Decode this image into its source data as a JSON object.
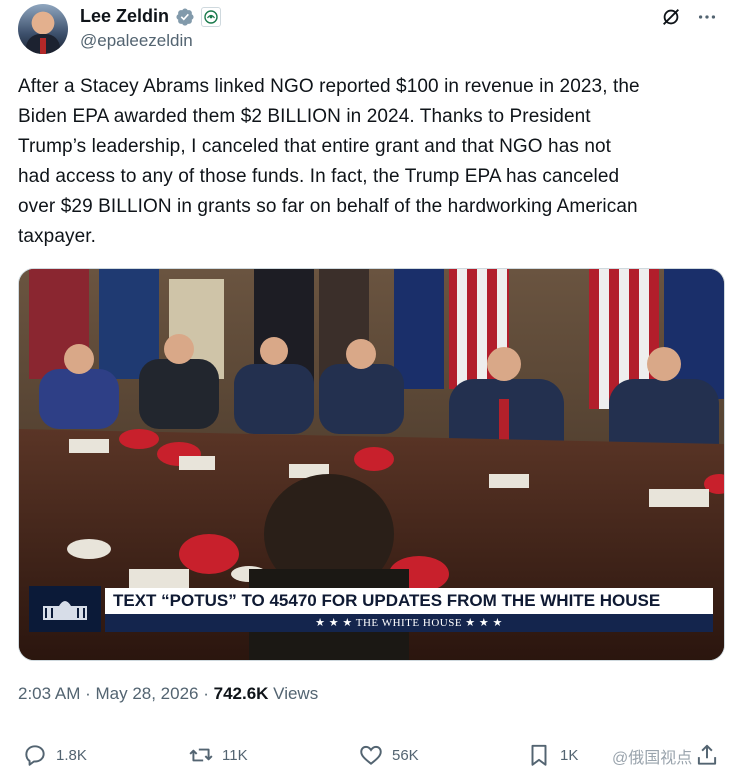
{
  "author": {
    "name": "Lee Zeldin",
    "handle": "@epaleezeldin"
  },
  "tweet": {
    "text": "After a Stacey Abrams linked NGO reported $100 in revenue in 2023, the\nBiden EPA awarded them $2 BILLION in 2024. Thanks to President\nTrump’s leadership, I canceled that entire grant and that NGO has not\nhad access to any of those funds. In fact, the Trump EPA has canceled\nover $29 BILLION in grants so far on behalf of the hardworking American\ntaxpayer."
  },
  "media": {
    "chyron_main": "TEXT “POTUS” TO 45470 FOR UPDATES FROM THE WHITE HOUSE",
    "chyron_sub": "★ ★ ★   THE WHITE HOUSE   ★ ★ ★"
  },
  "meta": {
    "time": "2:03 AM",
    "sep1": " · ",
    "date": "May 28, 2026",
    "sep2": " · ",
    "views_count": "742.6K",
    "views_label": " Views"
  },
  "actions": {
    "replies": "1.8K",
    "reposts": "11K",
    "likes": "56K",
    "bookmarks": "1K"
  },
  "watermark": "@俄国视点",
  "colors": {
    "verified": "#829aab",
    "text": "#0f1419",
    "secondary": "#536471"
  },
  "icons": [
    "verified-badge-icon",
    "agency-seal-icon",
    "grok-icon",
    "more-icon",
    "reply-icon",
    "repost-icon",
    "like-icon",
    "bookmark-icon",
    "share-icon"
  ]
}
